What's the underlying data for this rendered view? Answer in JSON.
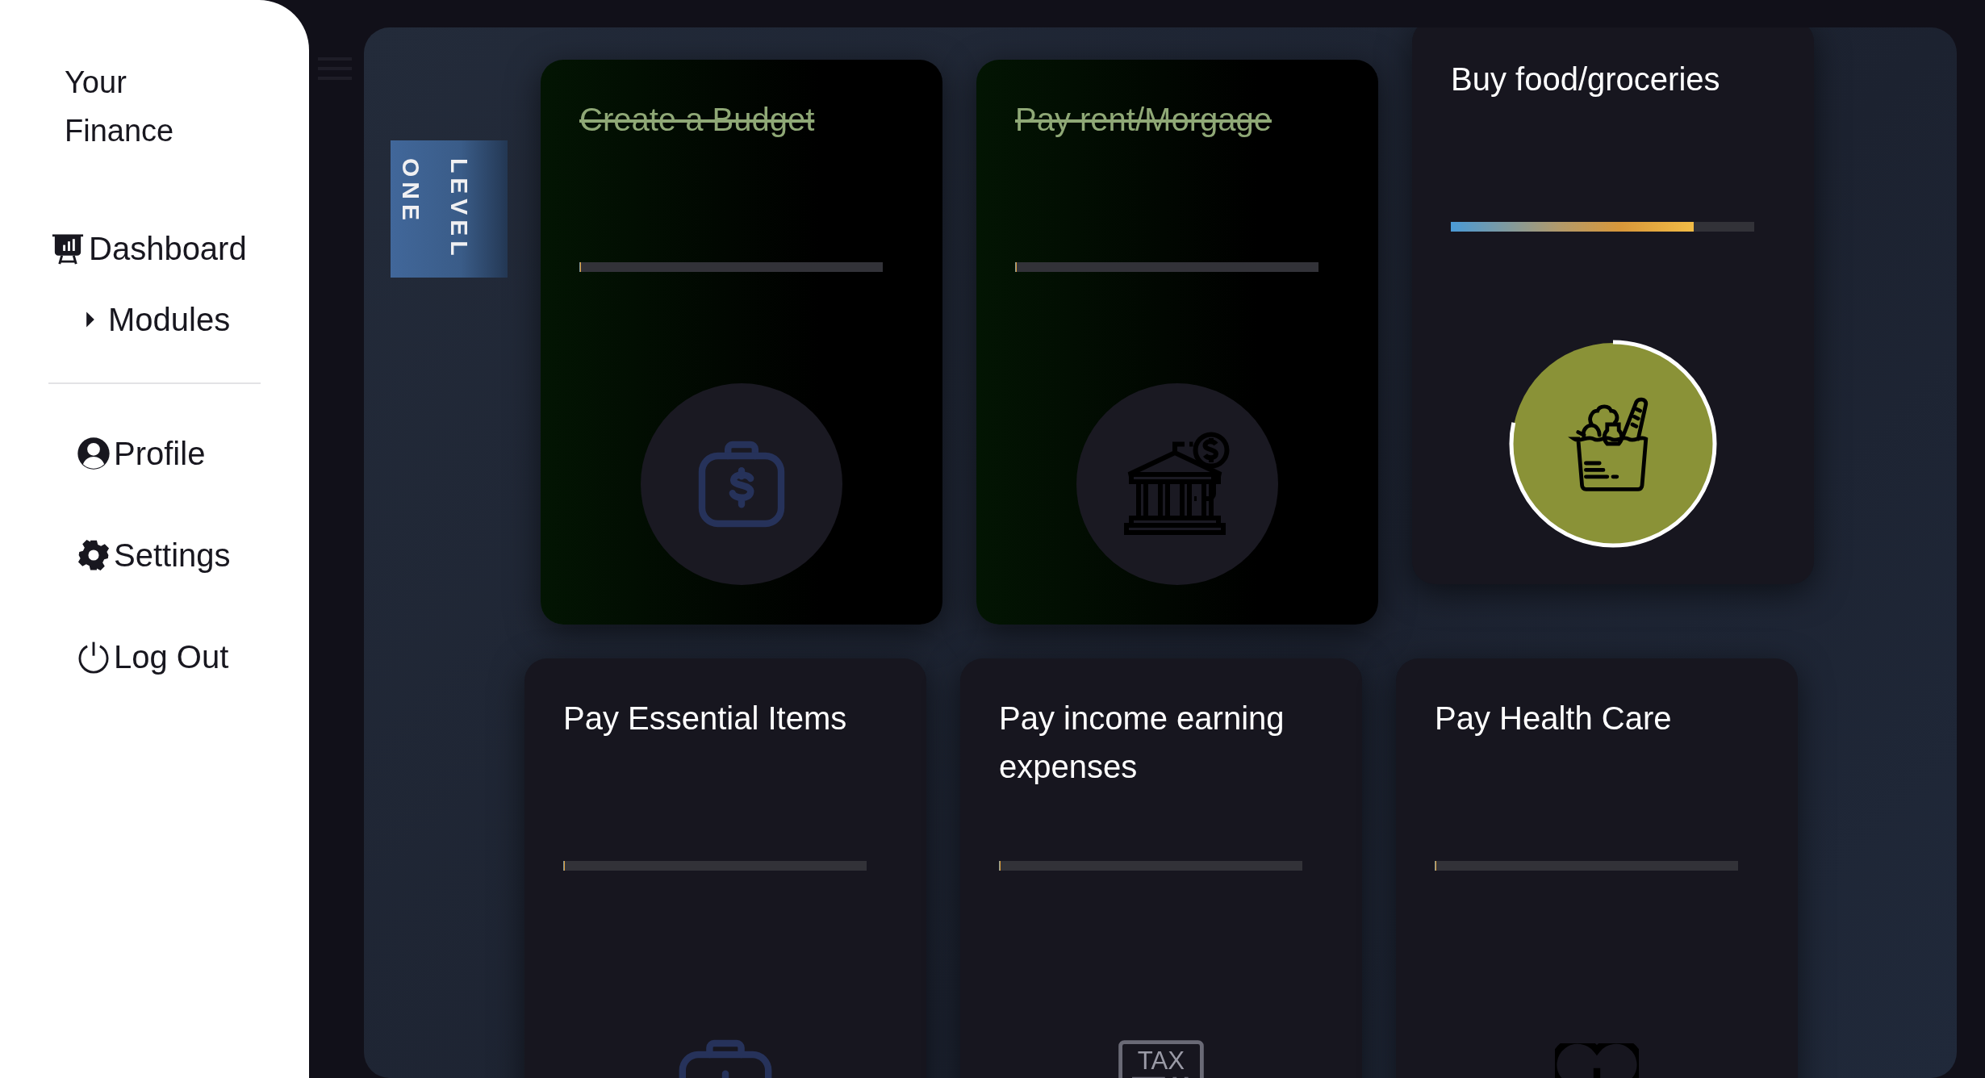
{
  "sidebar": {
    "title": "Your Finance",
    "nav": [
      {
        "label": "Dashboard",
        "kind": "link"
      },
      {
        "label": "Modules",
        "kind": "submenu",
        "expanded": false
      }
    ],
    "account": [
      {
        "label": "Profile"
      },
      {
        "label": "Settings"
      },
      {
        "label": "Log Out"
      }
    ]
  },
  "level_badge": "LEVEL ONE",
  "cards": [
    {
      "title": "Create a Budget",
      "completed": true,
      "active": false,
      "level": 0
    },
    {
      "title": "Pay rent/Morgage",
      "completed": true,
      "active": false,
      "level": 0
    },
    {
      "title": "Buy food/groceries",
      "completed": false,
      "active": true,
      "level": 0.8
    },
    {
      "title": "Pay Essential Items",
      "completed": false,
      "active": false,
      "level": 0
    },
    {
      "title": "Pay income earning expenses",
      "completed": false,
      "active": false,
      "level": 0,
      "icon_text": "TAX"
    },
    {
      "title": "Pay Health Care",
      "completed": false,
      "active": false,
      "level": 0
    }
  ]
}
